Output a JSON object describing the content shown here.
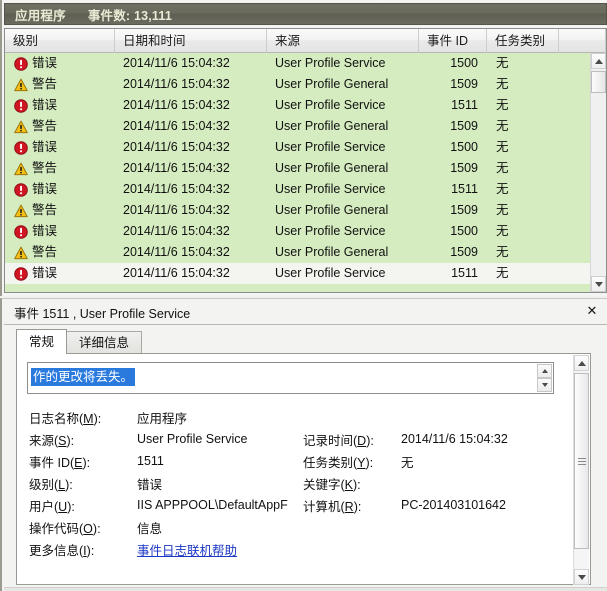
{
  "log_pane": {
    "title": "应用程序",
    "event_count_label": "事件数: 13,111",
    "columns": [
      {
        "key": "level",
        "label": "级别"
      },
      {
        "key": "date",
        "label": "日期和时间"
      },
      {
        "key": "source",
        "label": "来源"
      },
      {
        "key": "eventid",
        "label": "事件 ID"
      },
      {
        "key": "task",
        "label": "任务类别"
      }
    ],
    "rows": [
      {
        "icon": "error-icon",
        "level": "错误",
        "date": "2014/11/6 15:04:32",
        "source": "User Profile Service",
        "eventid": "1500",
        "task": "无",
        "selected": false
      },
      {
        "icon": "warning-icon",
        "level": "警告",
        "date": "2014/11/6 15:04:32",
        "source": "User Profile General",
        "eventid": "1509",
        "task": "无",
        "selected": false
      },
      {
        "icon": "error-icon",
        "level": "错误",
        "date": "2014/11/6 15:04:32",
        "source": "User Profile Service",
        "eventid": "1511",
        "task": "无",
        "selected": false
      },
      {
        "icon": "warning-icon",
        "level": "警告",
        "date": "2014/11/6 15:04:32",
        "source": "User Profile General",
        "eventid": "1509",
        "task": "无",
        "selected": false
      },
      {
        "icon": "error-icon",
        "level": "错误",
        "date": "2014/11/6 15:04:32",
        "source": "User Profile Service",
        "eventid": "1500",
        "task": "无",
        "selected": false
      },
      {
        "icon": "warning-icon",
        "level": "警告",
        "date": "2014/11/6 15:04:32",
        "source": "User Profile General",
        "eventid": "1509",
        "task": "无",
        "selected": false
      },
      {
        "icon": "error-icon",
        "level": "错误",
        "date": "2014/11/6 15:04:32",
        "source": "User Profile Service",
        "eventid": "1511",
        "task": "无",
        "selected": false
      },
      {
        "icon": "warning-icon",
        "level": "警告",
        "date": "2014/11/6 15:04:32",
        "source": "User Profile General",
        "eventid": "1509",
        "task": "无",
        "selected": false
      },
      {
        "icon": "error-icon",
        "level": "错误",
        "date": "2014/11/6 15:04:32",
        "source": "User Profile Service",
        "eventid": "1500",
        "task": "无",
        "selected": false
      },
      {
        "icon": "warning-icon",
        "level": "警告",
        "date": "2014/11/6 15:04:32",
        "source": "User Profile General",
        "eventid": "1509",
        "task": "无",
        "selected": false
      },
      {
        "icon": "error-icon",
        "level": "错误",
        "date": "2014/11/6 15:04:32",
        "source": "User Profile Service",
        "eventid": "1511",
        "task": "无",
        "selected": true
      }
    ]
  },
  "detail_pane": {
    "header_title": "事件 1511 , User Profile Service",
    "close_label": "✕",
    "tabs": [
      {
        "label": "常规",
        "active": true
      },
      {
        "label": "详细信息",
        "active": false
      }
    ],
    "description": "作的更改将丢失。",
    "fields": {
      "log_name_label": "日志名称(M):",
      "log_name_value": "应用程序",
      "source_label": "来源(S):",
      "source_value": "User Profile Service",
      "logged_label": "记录时间(D):",
      "logged_value": "2014/11/6 15:04:32",
      "event_id_label": "事件 ID(E):",
      "event_id_value": "1511",
      "task_category_label": "任务类别(Y):",
      "task_category_value": "无",
      "level_label": "级别(L):",
      "level_value": "错误",
      "keywords_label": "关键字(K):",
      "keywords_value": "",
      "user_label": "用户(U):",
      "user_value": "IIS APPPOOL\\DefaultAppF",
      "computer_label": "计算机(R):",
      "computer_value": "PC-201403101642",
      "opcode_label": "操作代码(O):",
      "opcode_value": "信息",
      "more_info_label": "更多信息(I):",
      "more_info_link": "事件日志联机帮助"
    }
  },
  "colors": {
    "row_background": "#d5ecc0",
    "row_selected": "#f4f4f0",
    "title_bar": "#6a6a5d",
    "title_text": "#e9ecd5",
    "error_icon": "#cf1622",
    "warning_icon": "#f5c016",
    "link": "#1b36c4",
    "selection": "#2a7ade"
  }
}
